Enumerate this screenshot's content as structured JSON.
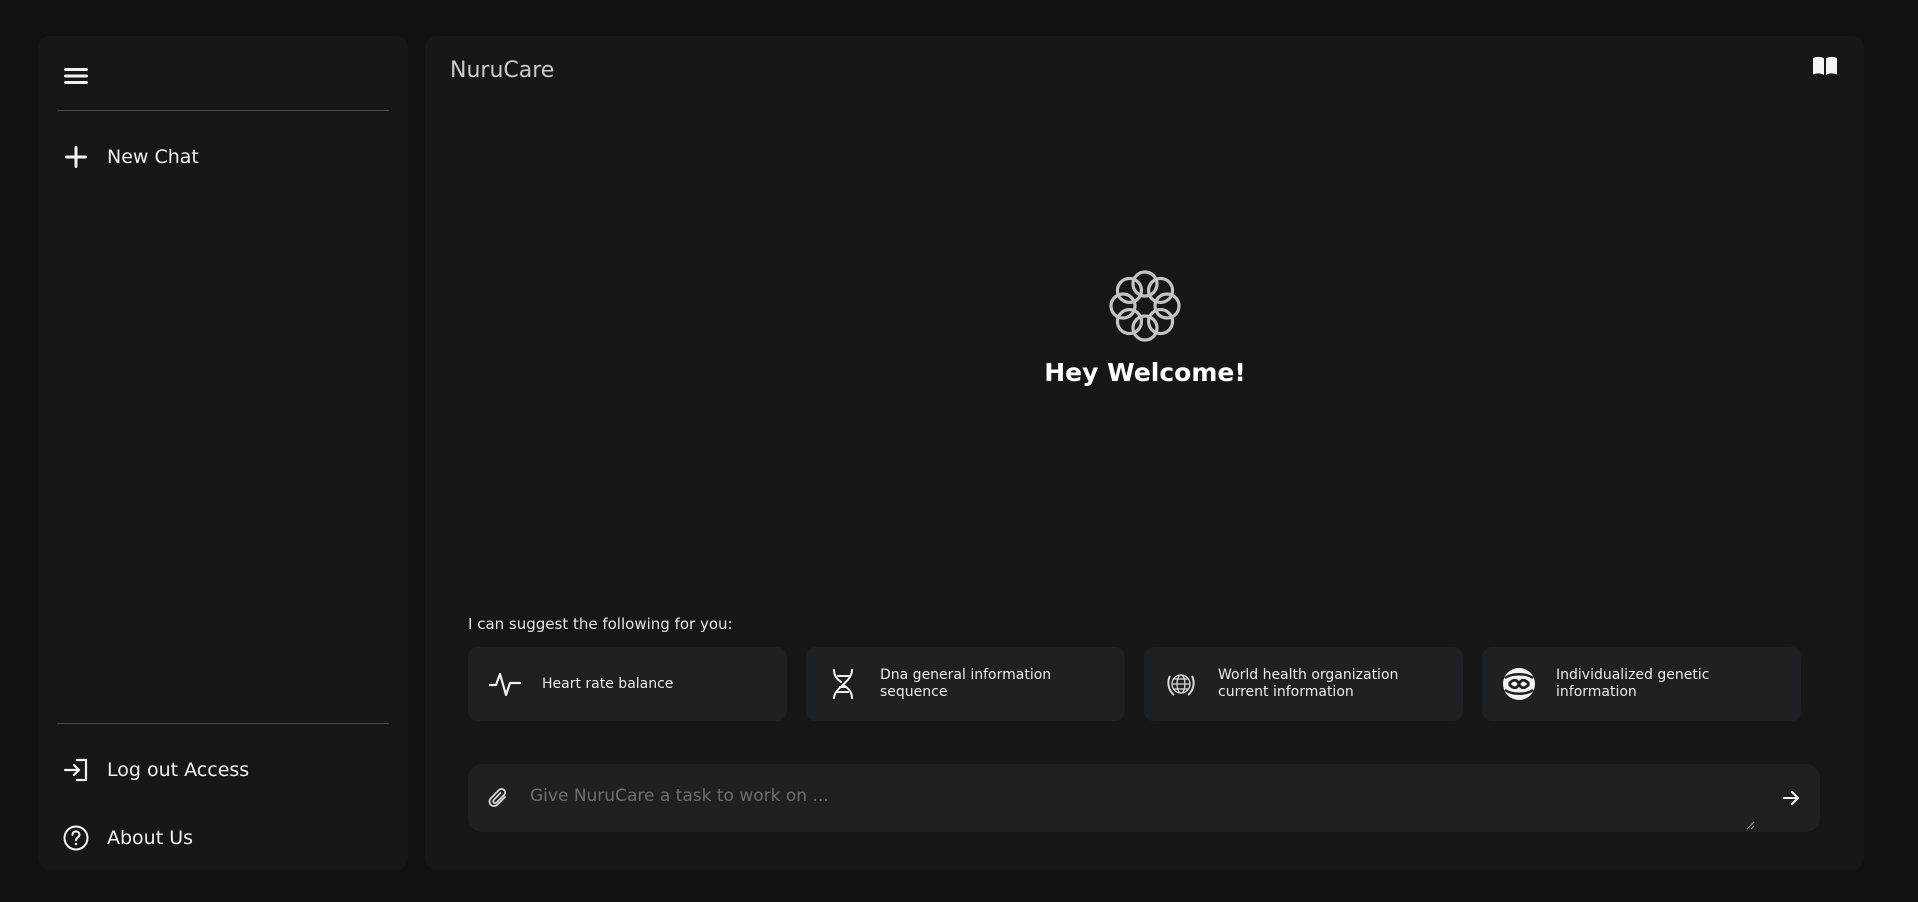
{
  "sidebar": {
    "new_chat_label": "New Chat",
    "logout_label": "Log out Access",
    "about_label": "About Us"
  },
  "header": {
    "brand": "NuruCare"
  },
  "hero": {
    "welcome": "Hey Welcome!"
  },
  "suggestions": {
    "label": "I can suggest the following for you:",
    "cards": [
      {
        "label": "Heart rate balance",
        "icon": "heart-rate-icon"
      },
      {
        "label": "Dna general information sequence",
        "icon": "dna-icon"
      },
      {
        "label": "World health organization current information",
        "icon": "un-emblem-icon"
      },
      {
        "label": "Individualized genetic information",
        "icon": "genetic-icon"
      }
    ]
  },
  "composer": {
    "placeholder": "Give NuruCare a task to work on ...",
    "value": ""
  },
  "colors": {
    "page_bg": "#111112",
    "panel_bg": "#171718",
    "card_bg": "#1f2022",
    "text": "#e8e8e8"
  }
}
